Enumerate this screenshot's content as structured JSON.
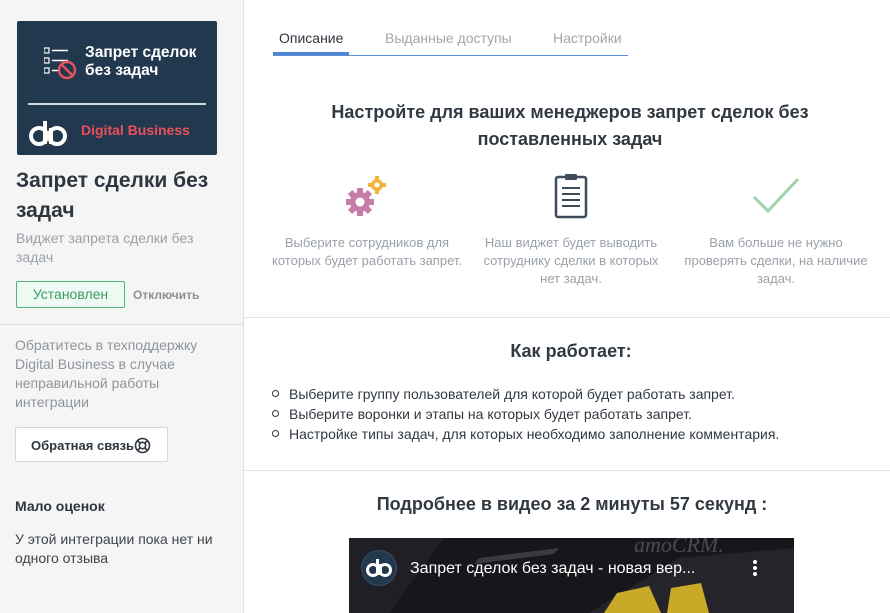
{
  "sidebar": {
    "logo": {
      "title": "Запрет сделок без задач",
      "brand": "Digital Business"
    },
    "app_title": "Запрет сделки без задач",
    "app_subtitle": "Виджет запрета сделки без задач",
    "installed_label": "Установлен",
    "disable_label": "Отключить",
    "support_text": "Обратитесь в техподдержку Digital Business в случае неправильной работы интеграции",
    "feedback_label": "Обратная связь",
    "rating_title": "Мало оценок",
    "rating_text": "У этой интеграции пока нет ни одного отзыва"
  },
  "tabs": [
    {
      "label": "Описание",
      "active": true
    },
    {
      "label": "Выданные доступы",
      "active": false
    },
    {
      "label": "Настройки",
      "active": false
    }
  ],
  "main": {
    "headline": "Настройте для ваших менеджеров запрет сделок без поставленных задач",
    "features": [
      {
        "icon": "gears-icon",
        "text": "Выберите сотрудников для которых будет работать запрет."
      },
      {
        "icon": "clipboard-icon",
        "text": "Наш виджет будет выводить сотруднику сделки в которых нет задач."
      },
      {
        "icon": "checkmark-icon",
        "text": "Вам больше не нужно проверять сделки, на наличие задач."
      }
    ],
    "how_title": "Как работает:",
    "how_items": [
      "Выберите группу пользователей для которой будет работать запрет.",
      "Выберите воронки и этапы на которых будет работать запрет.",
      "Настройке типы задач, для которых необходимо заполнение комментария."
    ],
    "video_heading": "Подробнее в видео за 2 минуты 57 секунд :",
    "video": {
      "title": "Запрет сделок без задач - новая вер..."
    }
  },
  "colors": {
    "accent_blue": "#4f86d1",
    "installed_green": "#4fb477",
    "logo_bg": "#22384f",
    "brand_red": "#e8505b"
  }
}
